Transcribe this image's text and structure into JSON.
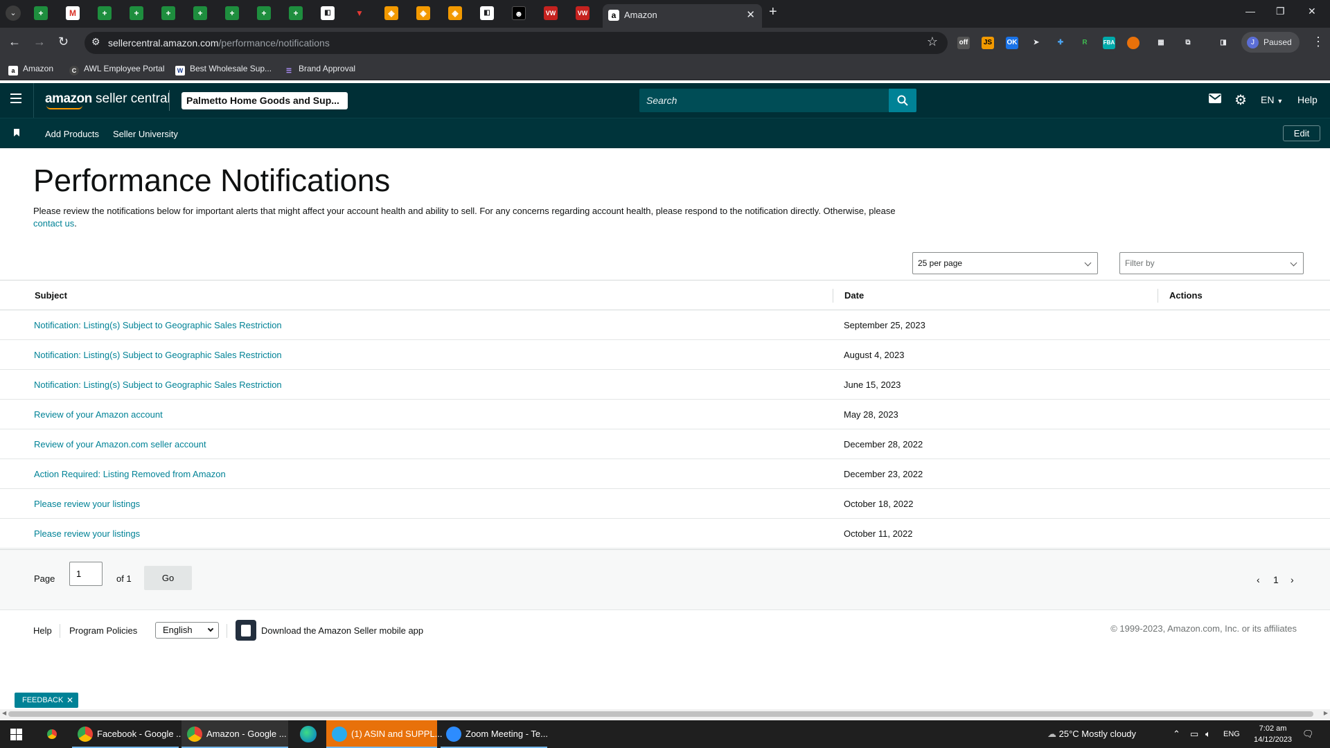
{
  "browser": {
    "active_tab_title": "Amazon",
    "url_host": "sellercentral.amazon.com",
    "url_path": "/performance/notifications",
    "profile_status": "Paused",
    "profile_initial": "J",
    "bookmarks": [
      {
        "label": "Amazon"
      },
      {
        "label": "AWL Employee Portal"
      },
      {
        "label": "Best Wholesale Sup..."
      },
      {
        "label": "Brand Approval"
      }
    ]
  },
  "header": {
    "logo_text_bold": "amazon",
    "logo_text": " seller central",
    "store_name": "Palmetto Home Goods and Sup...",
    "search_placeholder": "Search",
    "language": "EN",
    "help": "Help"
  },
  "subnav": {
    "links": [
      "Add Products",
      "Seller University"
    ],
    "edit": "Edit"
  },
  "main": {
    "title": "Performance Notifications",
    "description": "Please review the notifications below for important alerts that might affect your account health and ability to sell. For any concerns regarding account health, please respond to the notification directly. Otherwise, please ",
    "contact_link": "contact us",
    "description_end": ".",
    "per_page": "25 per page",
    "filter_placeholder": "Filter by",
    "columns": [
      "Subject",
      "Date",
      "Actions"
    ],
    "rows": [
      {
        "subject": "Notification: Listing(s) Subject to Geographic Sales Restriction",
        "date": "September 25, 2023"
      },
      {
        "subject": "Notification: Listing(s) Subject to Geographic Sales Restriction",
        "date": "August 4, 2023"
      },
      {
        "subject": "Notification: Listing(s) Subject to Geographic Sales Restriction",
        "date": "June 15, 2023"
      },
      {
        "subject": "Review of your Amazon account",
        "date": "May 28, 2023"
      },
      {
        "subject": "Review of your Amazon.com seller account",
        "date": "December 28, 2022"
      },
      {
        "subject": "Action Required: Listing Removed from Amazon",
        "date": "December 23, 2022"
      },
      {
        "subject": "Please review your listings",
        "date": "October 18, 2022"
      },
      {
        "subject": "Please review your listings",
        "date": "October 11, 2022"
      }
    ],
    "pager": {
      "page_label": "Page",
      "page_value": "1",
      "of_label": "of 1",
      "go": "Go",
      "current": "1"
    }
  },
  "footer": {
    "help": "Help",
    "policies": "Program Policies",
    "language": "English",
    "app_text": "Download the Amazon Seller mobile app",
    "copyright": "© 1999-2023, Amazon.com, Inc. or its affiliates"
  },
  "feedback": "FEEDBACK",
  "taskbar": {
    "apps": [
      {
        "label": "Facebook - Google ..."
      },
      {
        "label": "Amazon - Google ..."
      },
      {
        "label": "(1) ASIN and SUPPL..."
      },
      {
        "label": "Zoom Meeting - Te..."
      }
    ],
    "weather": "25°C  Mostly cloudy",
    "lang": "ENG",
    "time": "7:02 am",
    "date": "14/12/2023"
  },
  "colors": {
    "header_bg": "#002f36",
    "link": "#008296",
    "accent": "#ff9900"
  }
}
